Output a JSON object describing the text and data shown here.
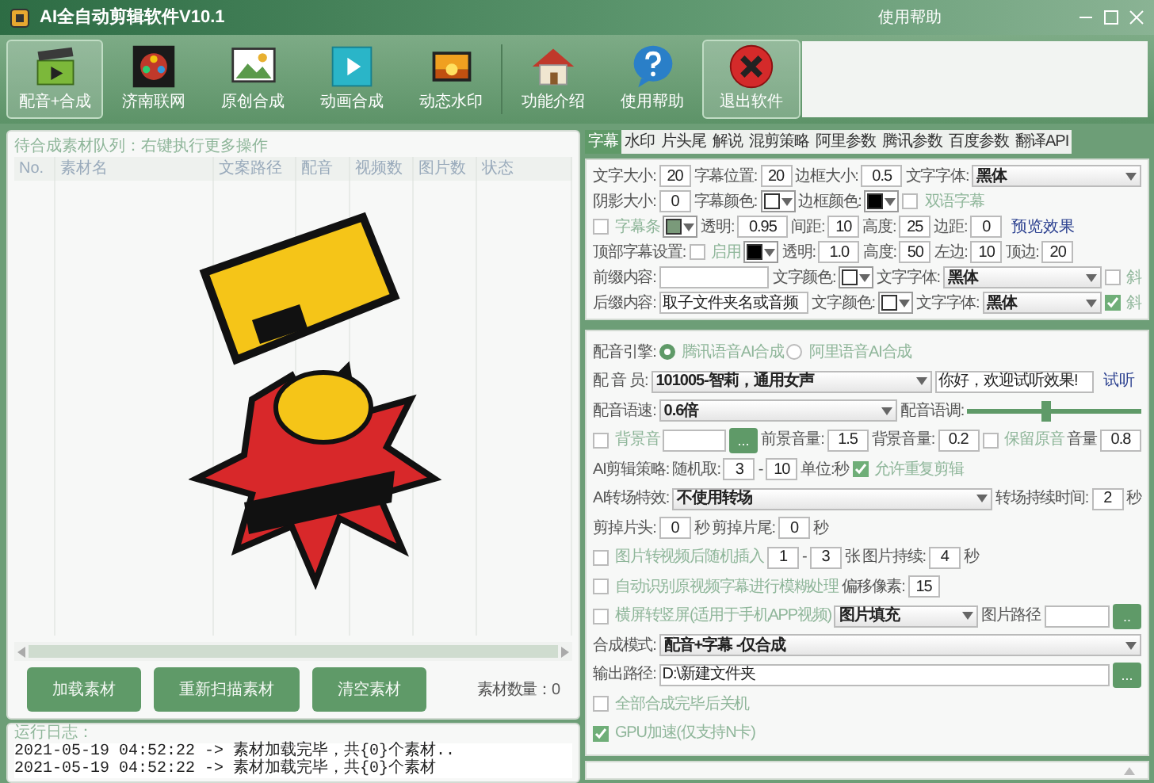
{
  "window": {
    "title": "AI全自动剪辑软件V10.1",
    "help": "使用帮助"
  },
  "toolbar": [
    {
      "label": "配音+合成",
      "highlighted": true
    },
    {
      "label": "济南联网",
      "highlighted": false
    },
    {
      "label": "原创合成",
      "highlighted": false
    },
    {
      "label": "动画合成",
      "highlighted": false
    },
    {
      "label": "动态水印",
      "highlighted": false
    },
    {
      "label": "功能介绍",
      "highlighted": false
    },
    {
      "label": "使用帮助",
      "highlighted": false
    },
    {
      "label": "退出软件",
      "highlighted": true
    }
  ],
  "queue": {
    "title": "待合成素材队列：右键执行更多操作",
    "columns": [
      "No.",
      "素材名",
      "文案路径",
      "配音",
      "视频数",
      "图片数",
      "状态"
    ],
    "buttons": [
      "加载素材",
      "重新扫描素材",
      "清空素材"
    ],
    "count": "素材数量：0"
  },
  "log": {
    "title": "运行日志：",
    "lines": [
      "2021-05-19 04:52:22 -> 素材加载完毕，共{0}个素材..",
      "2021-05-19 04:52:22 -> 素材加载完毕，共{0}个素材"
    ]
  },
  "tabs": [
    {
      "label": "字幕",
      "selected": true
    },
    {
      "label": "水印",
      "selected": false
    },
    {
      "label": "片头尾",
      "selected": false
    },
    {
      "label": "解说",
      "selected": false
    },
    {
      "label": "混剪策略",
      "selected": false
    },
    {
      "label": "阿里参数",
      "selected": false
    },
    {
      "label": "腾讯参数",
      "selected": false
    },
    {
      "label": "百度参数",
      "selected": false
    },
    {
      "label": "翻译API",
      "selected": false
    }
  ],
  "subtitle": {
    "rows": [
      {
        "items": [
          {
            "kind": "label",
            "text": "文字大小:"
          },
          {
            "kind": "num",
            "value": "20"
          },
          {
            "kind": "label",
            "text": "字幕位置:"
          },
          {
            "kind": "num",
            "value": "20"
          },
          {
            "kind": "label",
            "text": "边框大小:"
          },
          {
            "kind": "num",
            "value": "0.5"
          },
          {
            "kind": "label",
            "text": "文字字体:"
          },
          {
            "kind": "select",
            "text": "黑体"
          }
        ]
      },
      {
        "items": [
          {
            "kind": "label",
            "text": "阴影大小:"
          },
          {
            "kind": "num",
            "value": "0"
          },
          {
            "kind": "label",
            "text": "字幕颜色:"
          },
          {
            "kind": "color",
            "color": "#ffffff"
          },
          {
            "kind": "label",
            "text": "边框颜色:"
          },
          {
            "kind": "color",
            "color": "#000000"
          },
          {
            "kind": "check",
            "text": "双语字幕",
            "checked": false
          }
        ]
      },
      {
        "items": [
          {
            "kind": "check",
            "text": "字幕条",
            "checked": false
          },
          {
            "kind": "color",
            "color": "#7a9a7a"
          },
          {
            "kind": "label",
            "text": "透明:"
          },
          {
            "kind": "num",
            "value": "0.95"
          },
          {
            "kind": "label",
            "text": "间距:"
          },
          {
            "kind": "num",
            "value": "10"
          },
          {
            "kind": "label",
            "text": "高度:"
          },
          {
            "kind": "num",
            "value": "25"
          },
          {
            "kind": "label",
            "text": "边距:"
          },
          {
            "kind": "num",
            "value": "0"
          },
          {
            "kind": "link",
            "text": "预览效果"
          }
        ]
      },
      {
        "items": [
          {
            "kind": "label",
            "text": "顶部字幕设置:"
          },
          {
            "kind": "check",
            "text": "启用",
            "checked": false
          },
          {
            "kind": "color",
            "color": "#000000"
          },
          {
            "kind": "label",
            "text": "透明:"
          },
          {
            "kind": "num",
            "value": "1.0"
          },
          {
            "kind": "label",
            "text": "高度:"
          },
          {
            "kind": "num",
            "value": "50"
          },
          {
            "kind": "label",
            "text": "左边:"
          },
          {
            "kind": "num",
            "value": "10"
          },
          {
            "kind": "label",
            "text": "顶边:"
          },
          {
            "kind": "num",
            "value": "20"
          }
        ]
      },
      {
        "items": [
          {
            "kind": "label",
            "text": "前缀内容:"
          },
          {
            "kind": "text"
          },
          {
            "kind": "label",
            "text": "文字颜色:"
          },
          {
            "kind": "color",
            "color": "#ffffff"
          },
          {
            "kind": "label",
            "text": "文字字体:"
          },
          {
            "kind": "select",
            "text": "黑体"
          },
          {
            "kind": "check",
            "text": "斜",
            "checked": false
          }
        ]
      },
      {
        "items": [
          {
            "kind": "label",
            "text": "后缀内容:"
          },
          {
            "kind": "text",
            "value": "取子文件夹名或音频"
          },
          {
            "kind": "label",
            "text": "文字颜色:"
          },
          {
            "kind": "color",
            "color": "#ffffff"
          },
          {
            "kind": "label",
            "text": "文字字体:"
          },
          {
            "kind": "select",
            "text": "黑体"
          },
          {
            "kind": "check",
            "text": "斜",
            "checked": true
          }
        ]
      }
    ]
  },
  "voice": {
    "rows": [
      {
        "items": [
          {
            "kind": "label",
            "text": "配音引擎:"
          },
          {
            "kind": "radio",
            "text": "腾讯语音AI合成",
            "selected": true
          },
          {
            "kind": "radio",
            "text": "阿里语音AI合成",
            "selected": false
          }
        ]
      },
      {
        "items": [
          {
            "kind": "label",
            "text": "配 音 员:"
          },
          {
            "kind": "select",
            "text": "101005-智莉，通用女声"
          },
          {
            "kind": "text",
            "value": "你好，欢迎试听效果!"
          },
          {
            "kind": "link",
            "text": "试听"
          }
        ]
      },
      {
        "items": [
          {
            "kind": "label",
            "text": "配音语速:"
          },
          {
            "kind": "select",
            "text": "0.6倍"
          },
          {
            "kind": "label",
            "text": "配音语调:"
          },
          {
            "kind": "slider",
            "level": 0.45
          }
        ]
      },
      {
        "items": [
          {
            "kind": "check",
            "text": "背景音",
            "checked": false
          },
          {
            "kind": "text"
          },
          {
            "kind": "browse",
            "text": "..."
          },
          {
            "kind": "label",
            "text": "前景音量:"
          },
          {
            "kind": "num",
            "value": "1.5"
          },
          {
            "kind": "label",
            "text": "背景音量:"
          },
          {
            "kind": "num",
            "value": "0.2"
          },
          {
            "kind": "check",
            "text": "保留原音",
            "checked": false
          },
          {
            "kind": "label",
            "text": "音量"
          },
          {
            "kind": "num",
            "value": "0.8"
          }
        ]
      },
      {
        "items": [
          {
            "kind": "label",
            "text": "AI剪辑策略:"
          },
          {
            "kind": "label",
            "text": "随机取:"
          },
          {
            "kind": "num",
            "value": "3"
          },
          {
            "kind": "label",
            "text": "-"
          },
          {
            "kind": "num",
            "value": "10"
          },
          {
            "kind": "label",
            "text": "单位:秒"
          },
          {
            "kind": "check",
            "text": "允许重复剪辑",
            "checked": true
          }
        ]
      },
      {
        "items": [
          {
            "kind": "label",
            "text": "AI转场特效:"
          },
          {
            "kind": "select",
            "text": "不使用转场"
          },
          {
            "kind": "label",
            "text": "转场持续时间:"
          },
          {
            "kind": "num",
            "value": "2"
          },
          {
            "kind": "label",
            "text": "秒"
          }
        ]
      },
      {
        "items": [
          {
            "kind": "label",
            "text": "剪掉片头:"
          },
          {
            "kind": "num",
            "value": "0"
          },
          {
            "kind": "label",
            "text": "秒"
          },
          {
            "kind": "label",
            "text": "剪掉片尾:"
          },
          {
            "kind": "num",
            "value": "0"
          },
          {
            "kind": "label",
            "text": "秒"
          }
        ]
      },
      {
        "items": [
          {
            "kind": "check",
            "text": "图片转视频后随机插入",
            "checked": false
          },
          {
            "kind": "num",
            "value": "1"
          },
          {
            "kind": "label",
            "text": "-"
          },
          {
            "kind": "num",
            "value": "3"
          },
          {
            "kind": "label",
            "text": "张"
          },
          {
            "kind": "label",
            "text": "图片持续:"
          },
          {
            "kind": "num",
            "value": "4"
          },
          {
            "kind": "label",
            "text": "秒"
          }
        ]
      },
      {
        "items": [
          {
            "kind": "check",
            "text": "自动识别原视频字幕进行模糊处理",
            "checked": false
          },
          {
            "kind": "label",
            "text": "偏移像素:"
          },
          {
            "kind": "num",
            "value": "15"
          }
        ]
      },
      {
        "items": [
          {
            "kind": "check",
            "text": "横屏转竖屏(适用于手机APP视频)",
            "checked": false
          },
          {
            "kind": "select",
            "text": "图片填充"
          },
          {
            "kind": "label",
            "text": "图片路径"
          },
          {
            "kind": "text"
          },
          {
            "kind": "browse",
            "text": ".."
          }
        ]
      },
      {
        "items": [
          {
            "kind": "label",
            "text": "合成模式:"
          },
          {
            "kind": "select",
            "text": "配音+字幕 -仅合成"
          }
        ]
      },
      {
        "items": [
          {
            "kind": "label",
            "text": "输出路径:"
          },
          {
            "kind": "text",
            "value": "D:\\新建文件夹"
          },
          {
            "kind": "browse",
            "text": "..."
          }
        ]
      },
      {
        "items": [
          {
            "kind": "check",
            "text": "全部合成完毕后关机",
            "checked": false
          }
        ]
      },
      {
        "items": [
          {
            "kind": "check",
            "text": "GPU加速(仅支持N卡)",
            "checked": true
          }
        ]
      }
    ]
  }
}
